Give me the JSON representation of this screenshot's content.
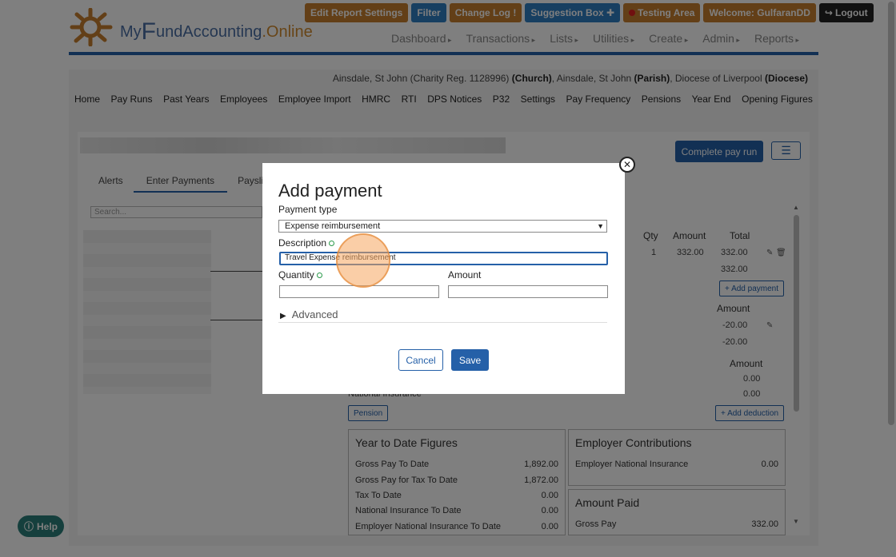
{
  "header": {
    "logo": {
      "prefix": "My",
      "f": "F",
      "middle": "und",
      "accounting": "Accounting",
      "online": ".Online"
    },
    "top_buttons": [
      {
        "label": "Edit Report Settings"
      },
      {
        "label": "Filter"
      },
      {
        "label": "Change Log !"
      },
      {
        "label": "Suggestion Box ✚"
      },
      {
        "label": "Testing Area"
      },
      {
        "label": "Welcome: GulfaranDD"
      },
      {
        "label": "Logout"
      }
    ],
    "nav": [
      "Dashboard",
      "Transactions",
      "Lists",
      "Utilities",
      "Create",
      "Admin",
      "Reports"
    ]
  },
  "org": {
    "parish_church": "Ainsdale, St John (Charity Reg. 1128996)",
    "church_tag": "(Church)",
    "parish": ", Ainsdale, St John",
    "parish_tag": "(Parish)",
    "diocese": ", Diocese of Liverpool",
    "diocese_tag": "(Diocese)"
  },
  "subnav": [
    "Home",
    "Pay Runs",
    "Past Years",
    "Employees",
    "Employee Import",
    "HMRC",
    "RTI",
    "DPS Notices",
    "P32",
    "Settings",
    "Pay Frequency",
    "Pensions",
    "Year End",
    "Opening Figures"
  ],
  "page": {
    "complete_pay_run": "Complete pay run",
    "menu_icon": "☰",
    "tabs": [
      "Alerts",
      "Enter Payments",
      "Payslip"
    ],
    "search_placeholder": "Search...",
    "payments": {
      "headers": {
        "qty": "Qty",
        "amount": "Amount",
        "total": "Total"
      },
      "row": {
        "qty": "1",
        "amount": "332.00",
        "total": "332.00"
      },
      "subtotal": "332.00",
      "add_payment": "+ Add payment"
    },
    "deductions_a": {
      "header": "Amount",
      "row": "-20.00",
      "subtotal": "-20.00"
    },
    "deductions_b": {
      "header": "Amount",
      "row1": "0.00",
      "row2": "0.00",
      "ni_label": "National Insurance"
    },
    "pension_btn": "Pension",
    "add_deduction": "+ Add deduction",
    "ytd": {
      "title": "Year to Date Figures",
      "rows": [
        {
          "label": "Gross Pay To Date",
          "value": "1,892.00"
        },
        {
          "label": "Gross Pay for Tax To Date",
          "value": "1,872.00"
        },
        {
          "label": "Tax To Date",
          "value": "0.00"
        },
        {
          "label": "National Insurance To Date",
          "value": "0.00"
        },
        {
          "label": "Employer National Insurance To Date",
          "value": "0.00"
        }
      ]
    },
    "employer": {
      "title": "Employer Contributions",
      "rows": [
        {
          "label": "Employer National Insurance",
          "value": "0.00"
        }
      ]
    },
    "amount_paid": {
      "title": "Amount Paid",
      "rows": [
        {
          "label": "Gross Pay",
          "value": "332.00"
        }
      ]
    }
  },
  "help": "Help",
  "modal": {
    "title": "Add payment",
    "payment_type_label": "Payment type",
    "payment_type_value": "Expense reimbursement",
    "description_label": "Description",
    "description_value": "Travel Expense reimbursement",
    "quantity_label": "Quantity",
    "quantity_value": "",
    "amount_label": "Amount",
    "amount_value": "",
    "advanced": "Advanced",
    "cancel": "Cancel",
    "save": "Save",
    "close": "✕"
  }
}
